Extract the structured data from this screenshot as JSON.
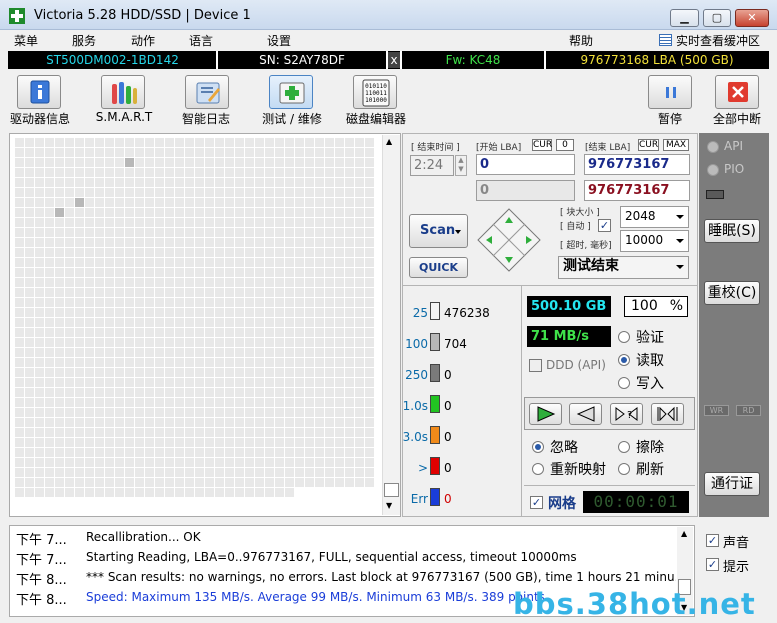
{
  "window": {
    "title": "Victoria 5.28 HDD/SSD | Device 1",
    "minimize": "▁",
    "maximize": "▢",
    "close": "✕"
  },
  "menu": {
    "items": [
      "菜单",
      "服务",
      "动作",
      "语言",
      "设置"
    ],
    "help": "帮助",
    "realtime": "实时查看缓冲区"
  },
  "drive": {
    "model": "ST500DM002-1BD142",
    "serial": "SN: S2AY78DF",
    "close": "x",
    "firmware": "Fw: KC48",
    "capacity": "976773168 LBA (500 GB)"
  },
  "toolbar": {
    "items": [
      {
        "label": "驱动器信息",
        "icon": "drive-info-icon"
      },
      {
        "label": "S.M.A.R.T",
        "icon": "smart-icon"
      },
      {
        "label": "智能日志",
        "icon": "smart-log-icon"
      },
      {
        "label": "测试 / 维修",
        "icon": "test-repair-icon"
      },
      {
        "label": "磁盘编辑器",
        "icon": "disk-editor-icon"
      }
    ],
    "pause": "暂停",
    "stop_all": "全部中断"
  },
  "scan": {
    "end_time_label": "[ 结束时间 ]",
    "end_time": "2:24",
    "start_lba_label": "[开始 LBA]",
    "cur_tag": "CUR",
    "zero_tag": "0",
    "end_lba_label": "[结束 LBA]",
    "max_tag": "MAX",
    "start_lba": "0",
    "end_lba": "976773167",
    "cur_lba": "0",
    "cur_end_lba": "976773167",
    "scan_button": "Scan",
    "quick_button": "QUICK",
    "block_size_label": "[ 块大小 ]",
    "auto_label": "[ 自动 ]",
    "block_size": "2048",
    "timeout_label": "[ 超时, 毫秒]",
    "timeout": "10000",
    "status": "测试结束"
  },
  "legend": [
    {
      "label": "25",
      "count": "476238",
      "color": "#f4f4f4"
    },
    {
      "label": "100",
      "count": "704",
      "color": "#b8b8b8"
    },
    {
      "label": "250",
      "count": "0",
      "color": "#7a7a7a"
    },
    {
      "label": "1.0s",
      "count": "0",
      "color": "#22c422"
    },
    {
      "label": "3.0s",
      "count": "0",
      "color": "#f08a1a"
    },
    {
      "label": ">",
      "count": "0",
      "color": "#e00000"
    },
    {
      "label": "Err",
      "count": "0",
      "color": "#1a3dd8"
    }
  ],
  "stats": {
    "size": "500.10 GB",
    "percent": "100",
    "percent_unit": "%",
    "speed": "71 MB/s",
    "ddd": "DDD (API)"
  },
  "modes": [
    {
      "label": "验证",
      "selected": false
    },
    {
      "label": "读取",
      "selected": true
    },
    {
      "label": "写入",
      "selected": false
    }
  ],
  "actions": [
    {
      "label": "忽略",
      "selected": true
    },
    {
      "label": "擦除",
      "selected": false
    },
    {
      "label": "重新映射",
      "selected": false
    },
    {
      "label": "刷新",
      "selected": false
    }
  ],
  "grid": {
    "label": "网格",
    "timer": "00:00:01",
    "highlighted": [
      [
        11,
        2
      ],
      [
        4,
        7
      ],
      [
        6,
        6
      ]
    ]
  },
  "side": {
    "api": "API",
    "pio": "PIO",
    "sleep": "睡眠(S)",
    "recal": "重校(C)",
    "wr": "WR",
    "rd": "RD",
    "passport": "通行证"
  },
  "log": [
    {
      "time": "下午 7...",
      "msg": "Recallibration... OK",
      "color": "#000000"
    },
    {
      "time": "下午 7...",
      "msg": "Starting Reading, LBA=0..976773167, FULL, sequential access, timeout 10000ms",
      "color": "#000000"
    },
    {
      "time": "下午 8...",
      "msg": "*** Scan results: no warnings, no errors. Last block at 976773167 (500 GB), time 1 hours 21 minu...",
      "color": "#000000"
    },
    {
      "time": "下午 8...",
      "msg": "Speed: Maximum 135 MB/s. Average 99 MB/s. Minimum 63 MB/s. 389 points.",
      "color": "#1a3dd8"
    }
  ],
  "options": {
    "sound": "声音",
    "hints": "提示"
  },
  "watermark": "bbs.38hot.net"
}
